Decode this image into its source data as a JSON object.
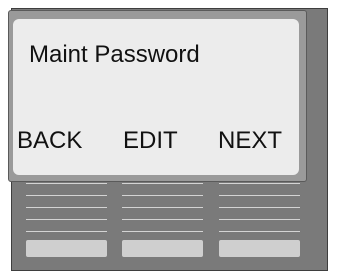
{
  "display": {
    "title": "Maint Password",
    "softkeys": {
      "back": "BACK",
      "edit": "EDIT",
      "next": "NEXT"
    }
  },
  "colors": {
    "housing": "#7a7a7a",
    "bezel": "#9a9a9a",
    "lcd_background": "#ececec",
    "text": "#111111",
    "hardware_buttons": "#cfcfcf"
  }
}
